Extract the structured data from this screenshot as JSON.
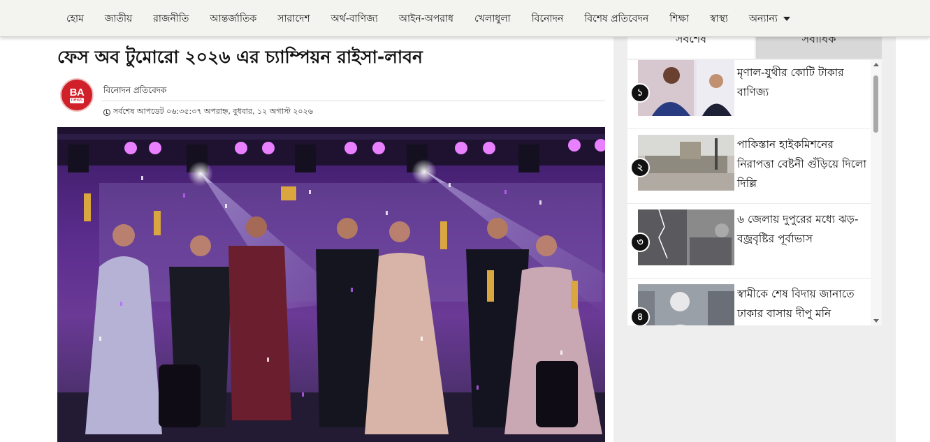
{
  "nav": {
    "items": [
      "হোম",
      "জাতীয়",
      "রাজনীতি",
      "আন্তর্জাতিক",
      "সারাদেশ",
      "অর্থ-বাণিজ্য",
      "আইন-অপরাধ",
      "খেলাধুলা",
      "বিনোদন",
      "বিশেষ প্রতিবেদন",
      "শিক্ষা",
      "স্বাস্থ্য"
    ],
    "more_label": "অন্যান্য",
    "more_icon": "caret-down-icon"
  },
  "article": {
    "headline": "ফেস অব টুমোরো ২০২৬ এর চ্যাম্পিয়ন রাইসা-লাবন",
    "logo": {
      "main": "BA",
      "sub": "news"
    },
    "author": "বিনোদন প্রতিবেদক",
    "updated": "সর্বশেষ আপডেট ০৬:৩৫:৩৭ অপরাহ্ন, বুধবার, ১২ অগাস্ট ২০২৬",
    "image_icon": "award-ceremony-photo"
  },
  "sidebar": {
    "tabs": [
      "সর্বশেষ",
      "সর্বাধিক"
    ],
    "items": [
      {
        "num": "১",
        "title": "মৃণাল-যুথীর কোটি টাকার বাণিজ্য"
      },
      {
        "num": "২",
        "title": "পাকিস্তান হাইকমিশনের নিরাপত্তা বেষ্টনী গুঁড়িয়ে দিলো দিল্লি"
      },
      {
        "num": "৩",
        "title": "৬ জেলায় দুপুরের মধ্যে ঝড়-বজ্রবৃষ্টির পূর্বাভাস"
      },
      {
        "num": "৪",
        "title": "স্বামীকে শেষ বিদায় জানাতে ঢাকার বাসায় দীপু মনি"
      }
    ]
  },
  "colors": {
    "logo_red": "#d0202a",
    "nav_bg": "#f3f3ef",
    "sidebar_bg": "#eeeeee"
  }
}
